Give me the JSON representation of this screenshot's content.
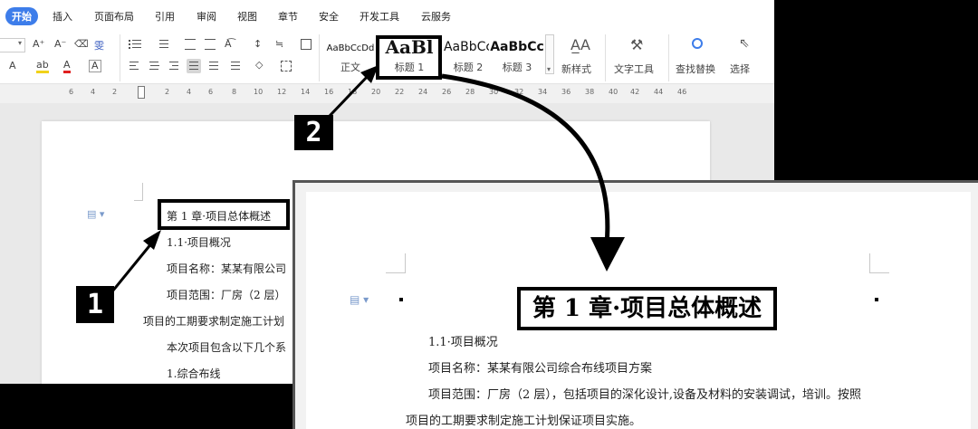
{
  "tabs": [
    "开始",
    "插入",
    "页面布局",
    "引用",
    "审阅",
    "视图",
    "章节",
    "安全",
    "开发工具",
    "云服务"
  ],
  "ribbon": {
    "font_row1": [
      "A⁺",
      "A⁻",
      "⌫",
      "雯"
    ],
    "font_row2": [
      "A",
      "ab",
      "A",
      "A"
    ],
    "styles": [
      {
        "sample": "AaBbCcDd",
        "name": "正文"
      },
      {
        "sample": "AaBl",
        "name": "标题 1"
      },
      {
        "sample": "AaBbCc",
        "name": "标题 2"
      },
      {
        "sample": "AaBbCc",
        "name": "标题 3"
      }
    ],
    "new_style": "新样式",
    "text_tools": "文字工具",
    "find_replace": "查找替换",
    "select": "选择"
  },
  "ruler_numbers": [
    "6",
    "4",
    "2",
    "2",
    "4",
    "6",
    "8",
    "10",
    "12",
    "14",
    "16",
    "18",
    "20",
    "22",
    "24",
    "26",
    "28",
    "30",
    "32",
    "34",
    "36",
    "38",
    "40",
    "42",
    "44",
    "46"
  ],
  "document": {
    "lines": [
      "第 1 章·项目总体概述",
      "1.1·项目概况",
      "项目名称：某某有限公司",
      "项目范围：厂房（2 层）",
      "项目的工期要求制定施工计划",
      "本次项目包含以下几个系",
      "1.综合布线"
    ]
  },
  "annotations": {
    "badge1": "1",
    "badge2": "2"
  },
  "inset": {
    "title": "第 1 章·项目总体概述",
    "lines": [
      "1.1·项目概况",
      "项目名称：某某有限公司综合布线项目方案",
      "项目范围：厂房（2 层），包括项目的深化设计,设备及材料的安装调试，培训。按照",
      "项目的工期要求制定施工计划保证项目实施。"
    ]
  }
}
